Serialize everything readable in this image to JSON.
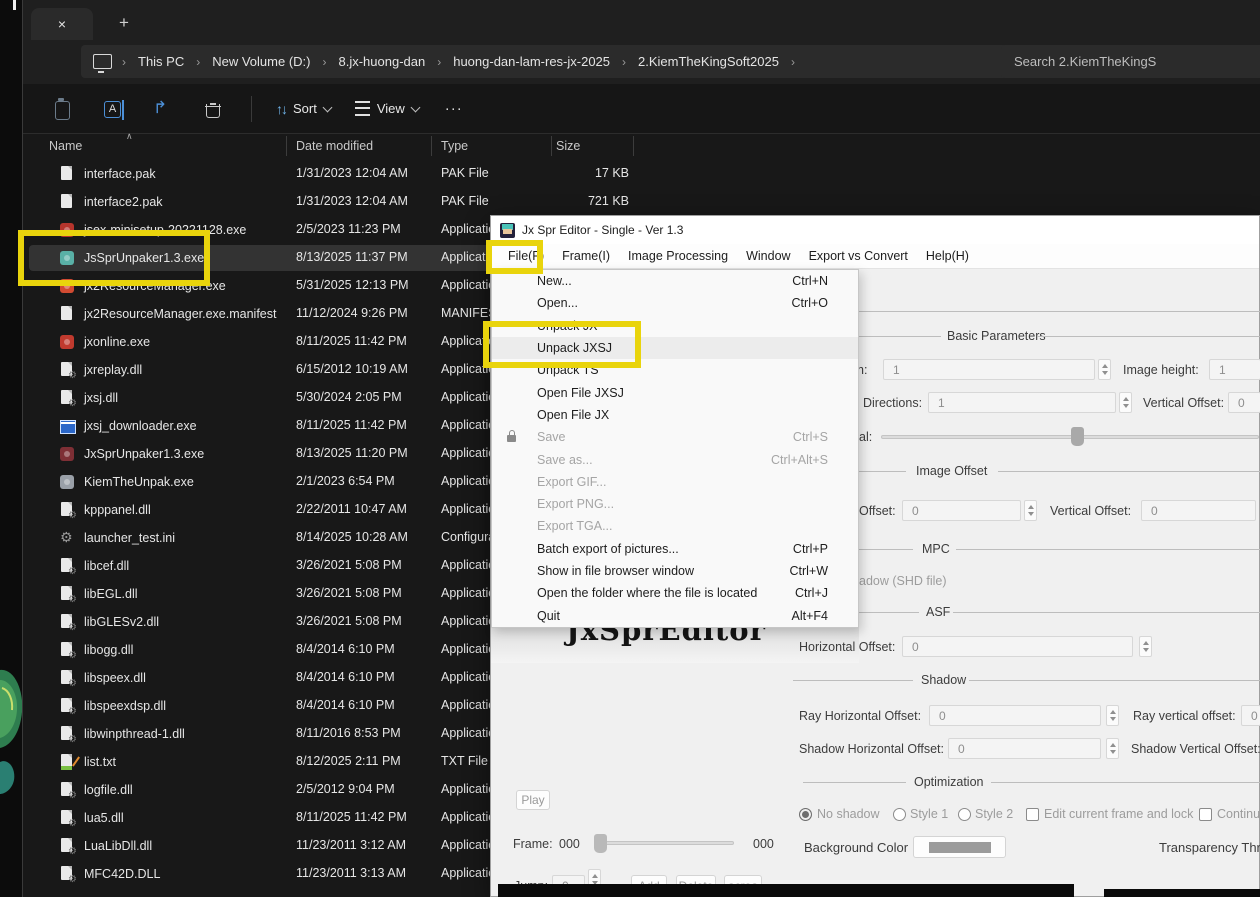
{
  "explorer": {
    "tab": {
      "close_glyph": "×",
      "new_glyph": "+"
    },
    "breadcrumb": [
      "This PC",
      "New Volume (D:)",
      "8.jx-huong-dan",
      "huong-dan-lam-res-jx-2025",
      "2.KiemTheKingSoft2025"
    ],
    "search_placeholder": "Search 2.KiemTheKingS",
    "toolbar": {
      "sort_label": "Sort",
      "view_label": "View",
      "more_glyph": "···"
    },
    "columns": {
      "name": "Name",
      "date": "Date modified",
      "type": "Type",
      "size": "Size",
      "sort_caret": "∧"
    },
    "files": [
      {
        "name": "interface.pak",
        "date": "1/31/2023 12:04 AM",
        "type": "PAK File",
        "size": "17 KB",
        "icon": "page",
        "color": ""
      },
      {
        "name": "interface2.pak",
        "date": "1/31/2023 12:04 AM",
        "type": "PAK File",
        "size": "721 KB",
        "icon": "page",
        "color": ""
      },
      {
        "name": "jsex-minisetup-20221128.exe",
        "date": "2/5/2023 11:23 PM",
        "type": "Application",
        "size": "",
        "icon": "exe",
        "color": "#b5342c"
      },
      {
        "name": "JsSprUnpaker1.3.exe",
        "date": "8/13/2025 11:37 PM",
        "type": "Application",
        "size": "",
        "icon": "exe",
        "color": "#59b0a6",
        "selected": true
      },
      {
        "name": "jx2ResourceManager.exe",
        "date": "5/31/2025 12:13 PM",
        "type": "Application",
        "size": "",
        "icon": "exe",
        "color": "#d24b32"
      },
      {
        "name": "jx2ResourceManager.exe.manifest",
        "date": "11/12/2024 9:26 PM",
        "type": "MANIFEST",
        "size": "",
        "icon": "page",
        "color": ""
      },
      {
        "name": "jxonline.exe",
        "date": "8/11/2025 11:42 PM",
        "type": "Application",
        "size": "",
        "icon": "exe",
        "color": "#c03a2e"
      },
      {
        "name": "jxreplay.dll",
        "date": "6/15/2012 10:19 AM",
        "type": "Application",
        "size": "",
        "icon": "dll",
        "color": ""
      },
      {
        "name": "jxsj.dll",
        "date": "5/30/2024 2:05 PM",
        "type": "Application",
        "size": "",
        "icon": "dll",
        "color": ""
      },
      {
        "name": "jxsj_downloader.exe",
        "date": "8/11/2025 11:42 PM",
        "type": "Application",
        "size": "",
        "icon": "win",
        "color": ""
      },
      {
        "name": "JxSprUnpaker1.3.exe",
        "date": "8/13/2025 11:20 PM",
        "type": "Application",
        "size": "",
        "icon": "exe",
        "color": "#7e2f35"
      },
      {
        "name": "KiemTheUnpak.exe",
        "date": "2/1/2023 6:54 PM",
        "type": "Application",
        "size": "",
        "icon": "exe",
        "color": "#9aa0a8"
      },
      {
        "name": "kpppanel.dll",
        "date": "2/22/2011 10:47 AM",
        "type": "Application",
        "size": "",
        "icon": "dll",
        "color": ""
      },
      {
        "name": "launcher_test.ini",
        "date": "8/14/2025 10:28 AM",
        "type": "Configuration",
        "size": "",
        "icon": "ini",
        "color": ""
      },
      {
        "name": "libcef.dll",
        "date": "3/26/2021 5:08 PM",
        "type": "Application",
        "size": "",
        "icon": "dll",
        "color": ""
      },
      {
        "name": "libEGL.dll",
        "date": "3/26/2021 5:08 PM",
        "type": "Application",
        "size": "",
        "icon": "dll",
        "color": ""
      },
      {
        "name": "libGLESv2.dll",
        "date": "3/26/2021 5:08 PM",
        "type": "Application",
        "size": "",
        "icon": "dll",
        "color": ""
      },
      {
        "name": "libogg.dll",
        "date": "8/4/2014 6:10 PM",
        "type": "Application",
        "size": "",
        "icon": "dll",
        "color": ""
      },
      {
        "name": "libspeex.dll",
        "date": "8/4/2014 6:10 PM",
        "type": "Application",
        "size": "",
        "icon": "dll",
        "color": ""
      },
      {
        "name": "libspeexdsp.dll",
        "date": "8/4/2014 6:10 PM",
        "type": "Application",
        "size": "",
        "icon": "dll",
        "color": ""
      },
      {
        "name": "libwinpthread-1.dll",
        "date": "8/11/2016 8:53 PM",
        "type": "Application",
        "size": "",
        "icon": "dll",
        "color": ""
      },
      {
        "name": "list.txt",
        "date": "8/12/2025 2:11 PM",
        "type": "TXT File",
        "size": "",
        "icon": "txt",
        "color": ""
      },
      {
        "name": "logfile.dll",
        "date": "2/5/2012 9:04 PM",
        "type": "Application",
        "size": "",
        "icon": "dll",
        "color": ""
      },
      {
        "name": "lua5.dll",
        "date": "8/11/2025 11:42 PM",
        "type": "Application",
        "size": "",
        "icon": "dll",
        "color": ""
      },
      {
        "name": "LuaLibDll.dll",
        "date": "11/23/2011 3:12 AM",
        "type": "Application",
        "size": "",
        "icon": "dll",
        "color": ""
      },
      {
        "name": "MFC42D.DLL",
        "date": "11/23/2011 3:13 AM",
        "type": "Application",
        "size": "",
        "icon": "dll",
        "color": ""
      }
    ]
  },
  "editor": {
    "title": "Jx Spr Editor - Single - Ver 1.3",
    "menus": [
      "File(F)",
      "Frame(I)",
      "Image Processing",
      "Window",
      "Export vs Convert",
      "Help(H)"
    ],
    "file_menu": [
      {
        "label": "New...",
        "shortcut": "Ctrl+N"
      },
      {
        "label": "Open...",
        "shortcut": "Ctrl+O"
      },
      {
        "label": "Unpack JX",
        "shortcut": ""
      },
      {
        "label": "Unpack JXSJ",
        "shortcut": "",
        "highlighted": true
      },
      {
        "label": "Unpack TS",
        "shortcut": ""
      },
      {
        "label": "Open File JXSJ",
        "shortcut": ""
      },
      {
        "label": "Open File JX",
        "shortcut": ""
      },
      {
        "label": "Save",
        "shortcut": "Ctrl+S",
        "disabled": true,
        "lock": true
      },
      {
        "label": "Save as...",
        "shortcut": "Ctrl+Alt+S",
        "disabled": true
      },
      {
        "label": "Export GIF...",
        "shortcut": "",
        "disabled": true
      },
      {
        "label": "Export PNG...",
        "shortcut": "",
        "disabled": true
      },
      {
        "label": "Export TGA...",
        "shortcut": "",
        "disabled": true
      },
      {
        "label": "Batch export of pictures...",
        "shortcut": "Ctrl+P"
      },
      {
        "label": "Show in file browser window",
        "shortcut": "Ctrl+W"
      },
      {
        "label": "Open the folder where the file is located",
        "shortcut": "Ctrl+J"
      },
      {
        "label": "Quit",
        "shortcut": "Alt+F4"
      }
    ],
    "watermark": "JxSprEditor",
    "panel": {
      "basic": {
        "title": "Basic Parameters",
        "width_label_fragment": "h:",
        "width_value": "1",
        "height_label": "Image height:",
        "height_value": "1",
        "directions_label": "Directions:",
        "directions_value": "1",
        "voffset_label": "Vertical Offset:",
        "voffset_value": "0",
        "interval_label_fragment": "al:"
      },
      "image_offset": {
        "title": "Image Offset",
        "h_label_fragment": "Offset:",
        "h_value": "0",
        "v_label": "Vertical Offset:",
        "v_value": "0"
      },
      "mpc": {
        "title": "MPC",
        "shadow_label_fragment": "adow (SHD file)"
      },
      "asf": {
        "title": "ASF",
        "h_label": "Horizontal Offset:",
        "h_value": "0"
      },
      "shadow": {
        "title": "Shadow",
        "ray_h_label": "Ray Horizontal Offset:",
        "ray_h_value": "0",
        "ray_v_label": "Ray vertical offset:",
        "ray_v_value": "0",
        "sh_h_label": "Shadow Horizontal Offset:",
        "sh_h_value": "0",
        "sh_v_label": "Shadow Vertical Offset:"
      },
      "optimization": {
        "title": "Optimization",
        "radio_no_shadow": "No shadow",
        "radio_style1": "Style 1",
        "radio_style2": "Style 2",
        "check_edit": "Edit current frame and lock",
        "check_continue_fragment": "Continu",
        "bg_color_label": "Background Color",
        "transparency_label_fragment": "Transparency Thres"
      }
    },
    "transport": {
      "play": "Play",
      "frame_label": "Frame:",
      "frame_value": "000",
      "frame_end_value": "000",
      "jump_label": "Jump:",
      "jump_value": "0",
      "add": "Add",
      "delete": "Delete",
      "extra_fragment": "acrea"
    }
  }
}
